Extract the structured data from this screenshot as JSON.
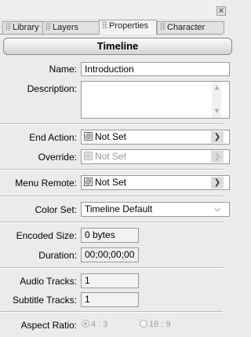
{
  "tabs": [
    {
      "label": "Library",
      "active": false
    },
    {
      "label": "Layers",
      "active": false
    },
    {
      "label": "Properties",
      "active": true
    },
    {
      "label": "Character",
      "active": false
    }
  ],
  "panel_title": "Timeline",
  "fields": {
    "name": {
      "label": "Name:",
      "value": "Introduction"
    },
    "description": {
      "label": "Description:",
      "value": ""
    },
    "end_action": {
      "label": "End Action:",
      "value": "Not Set"
    },
    "override": {
      "label": "Override:",
      "value": "Not Set",
      "enabled": false
    },
    "menu_remote": {
      "label": "Menu Remote:",
      "value": "Not Set"
    },
    "color_set": {
      "label": "Color Set:",
      "value": "Timeline Default"
    },
    "encoded_size": {
      "label": "Encoded Size:",
      "value": "0 bytes"
    },
    "duration": {
      "label": "Duration:",
      "value": "00;00;00;00"
    },
    "audio_tracks": {
      "label": "Audio Tracks:",
      "value": "1"
    },
    "subtitle_tracks": {
      "label": "Subtitle Tracks:",
      "value": "1"
    },
    "aspect_ratio": {
      "label": "Aspect Ratio:",
      "options": [
        "4 : 3",
        "16 : 9"
      ],
      "selected": "4 : 3",
      "enabled": false
    }
  },
  "icons": {
    "close": "close-icon",
    "select_link": "link-chip-icon",
    "select_arrow": "arrow-right-icon",
    "dropdown": "chevron-down-icon"
  }
}
